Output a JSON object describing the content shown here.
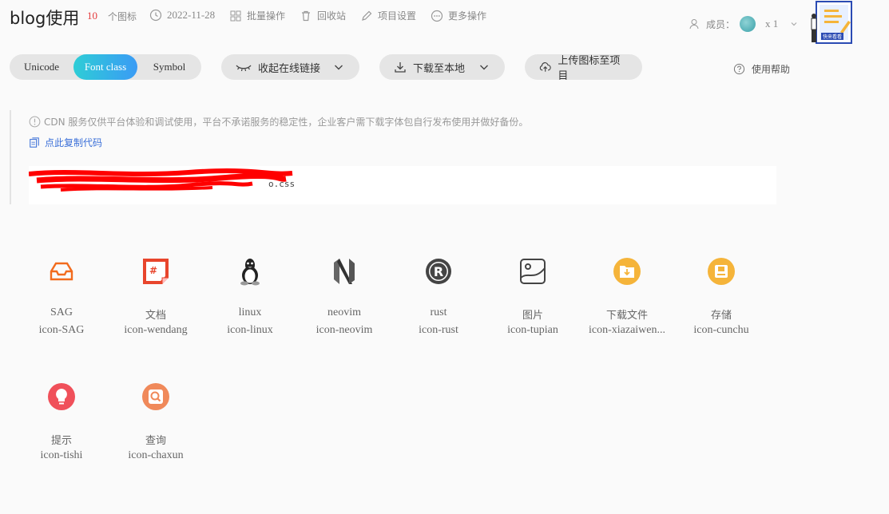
{
  "header": {
    "title": "blog使用",
    "icon_count": "10",
    "icon_count_label": "个图标",
    "date": "2022-11-28",
    "batch_label": "批量操作",
    "recycle_label": "回收站",
    "settings_label": "项目设置",
    "more_label": "更多操作",
    "members_label": "成员：",
    "members_count": "x 1",
    "promo_badge": "快来看看"
  },
  "toolbar": {
    "tabs": [
      "Unicode",
      "Font class",
      "Symbol"
    ],
    "active_tab": "Font class",
    "collapse_label": "收起在线链接",
    "download_label": "下载至本地",
    "upload_label": "上传图标至项目",
    "help_label": "使用帮助"
  },
  "notice": {
    "text": "CDN 服务仅供平台体验和调试使用，平台不承诺服务的稳定性，企业客户需下载字体包自行发布使用并做好备份。",
    "copy_label": "点此复制代码",
    "code_suffix": "o.css"
  },
  "icons": [
    {
      "name": "SAG",
      "class": "icon-SAG",
      "icon": "tray-icon",
      "color": "#f26b1d"
    },
    {
      "name": "文档",
      "class": "icon-wendang",
      "icon": "document-icon",
      "color": "#e8452c"
    },
    {
      "name": "linux",
      "class": "icon-linux",
      "icon": "penguin-icon",
      "color": "#333333"
    },
    {
      "name": "neovim",
      "class": "icon-neovim",
      "icon": "neovim-icon",
      "color": "#444444"
    },
    {
      "name": "rust",
      "class": "icon-rust",
      "icon": "rust-gear-icon",
      "color": "#444444"
    },
    {
      "name": "图片",
      "class": "icon-tupian",
      "icon": "image-icon",
      "color": "#444444"
    },
    {
      "name": "下载文件",
      "class": "icon-xiazaiwen...",
      "icon": "download-folder-icon",
      "color": "#f5b43a"
    },
    {
      "name": "存储",
      "class": "icon-cunchu",
      "icon": "storage-icon",
      "color": "#f5b43a"
    },
    {
      "name": "提示",
      "class": "icon-tishi",
      "icon": "bulb-icon",
      "color": "#f0505a"
    },
    {
      "name": "查询",
      "class": "icon-chaxun",
      "icon": "search-icon",
      "color": "#f0895a"
    }
  ]
}
